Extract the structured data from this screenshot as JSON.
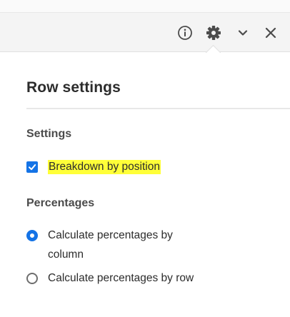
{
  "toolbar": {
    "icons": [
      "info-icon",
      "gear-icon",
      "chevron-down-icon",
      "close-icon"
    ]
  },
  "popover": {
    "title": "Row settings",
    "settings": {
      "heading": "Settings",
      "breakdown_label": "Breakdown by position",
      "breakdown_checked": true,
      "highlight_color": "#ffff38"
    },
    "percentages": {
      "heading": "Percentages",
      "options": [
        {
          "label": "Calculate percentages by column",
          "selected": true
        },
        {
          "label": "Calculate percentages by row",
          "selected": false
        }
      ]
    }
  },
  "colors": {
    "accent": "#1473e6",
    "text": "#2c2c2c",
    "toolbar_bg": "#f4f4f4"
  }
}
